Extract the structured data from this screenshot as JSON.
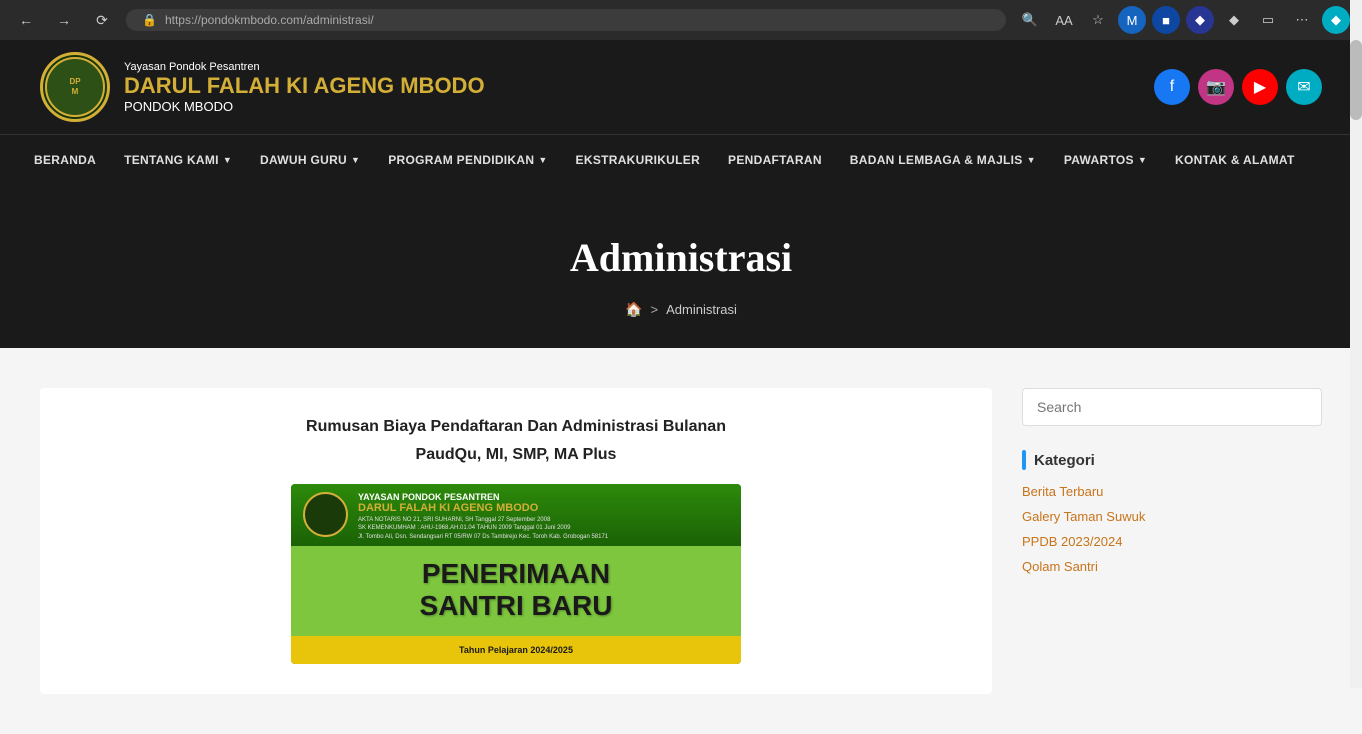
{
  "browser": {
    "url": "https://pondokmbodo.com/administrasi/",
    "url_display": "https://pondokmbodo.com/administrasi/"
  },
  "header": {
    "subtitle": "Yayasan Pondok Pesantren",
    "title": "DARUL FALAH KI AGENG MBODO",
    "tagline": "PONDOK MBODO",
    "logo_alt": "Logo"
  },
  "social": {
    "facebook": "f",
    "instagram": "📷",
    "youtube": "▶",
    "email": "✉"
  },
  "nav": {
    "items": [
      {
        "label": "BERANDA",
        "has_dropdown": false
      },
      {
        "label": "TENTANG KAMI",
        "has_dropdown": true
      },
      {
        "label": "DAWUH GURU",
        "has_dropdown": true
      },
      {
        "label": "PROGRAM PENDIDIKAN",
        "has_dropdown": true
      },
      {
        "label": "EKSTRAKURIKULER",
        "has_dropdown": false
      },
      {
        "label": "PENDAFTARAN",
        "has_dropdown": false
      },
      {
        "label": "BADAN LEMBAGA & MAJLIS",
        "has_dropdown": true
      },
      {
        "label": "PAWARTOS",
        "has_dropdown": true
      },
      {
        "label": "KONTAK & ALAMAT",
        "has_dropdown": false
      }
    ]
  },
  "hero": {
    "title": "Administrasi",
    "breadcrumb_home": "🏠",
    "breadcrumb_sep": ">",
    "breadcrumb_current": "Administrasi"
  },
  "article": {
    "title": "Rumusan Biaya Pendaftaran Dan Administrasi Bulanan",
    "subtitle": "PaudQu, MI, SMP, MA Plus",
    "image": {
      "org_name": "YAYASAN PONDOK PESANTREN",
      "org_name2": "DARUL FALAH KI AGENG MBODO",
      "details": "AKTA NOTARIS NO 21, SRI SUHARNI, SH Tanggal 27 September 2008\nSK KEMENKUMHAM : AHU-1968.AH.01.04 TAHUN 2009 Tanggal 01 Juni 2009\nJl. Tombo Ati, Dsn. Sendangsari RT 05/RW 07 Ds Tambirejo Kec. Toroh Kab. Grobogan 58171",
      "main_text1": "PENERIMAAN",
      "main_text2": "SANTRI BARU",
      "band_text": "Tahun Pelajaran 2024/2025"
    }
  },
  "sidebar": {
    "search_placeholder": "Search",
    "categories_title": "Kategori",
    "categories": [
      {
        "label": "Berita Terbaru"
      },
      {
        "label": "Galery Taman Suwuk"
      },
      {
        "label": "PPDB 2023/2024"
      },
      {
        "label": "Qolam Santri"
      }
    ]
  }
}
